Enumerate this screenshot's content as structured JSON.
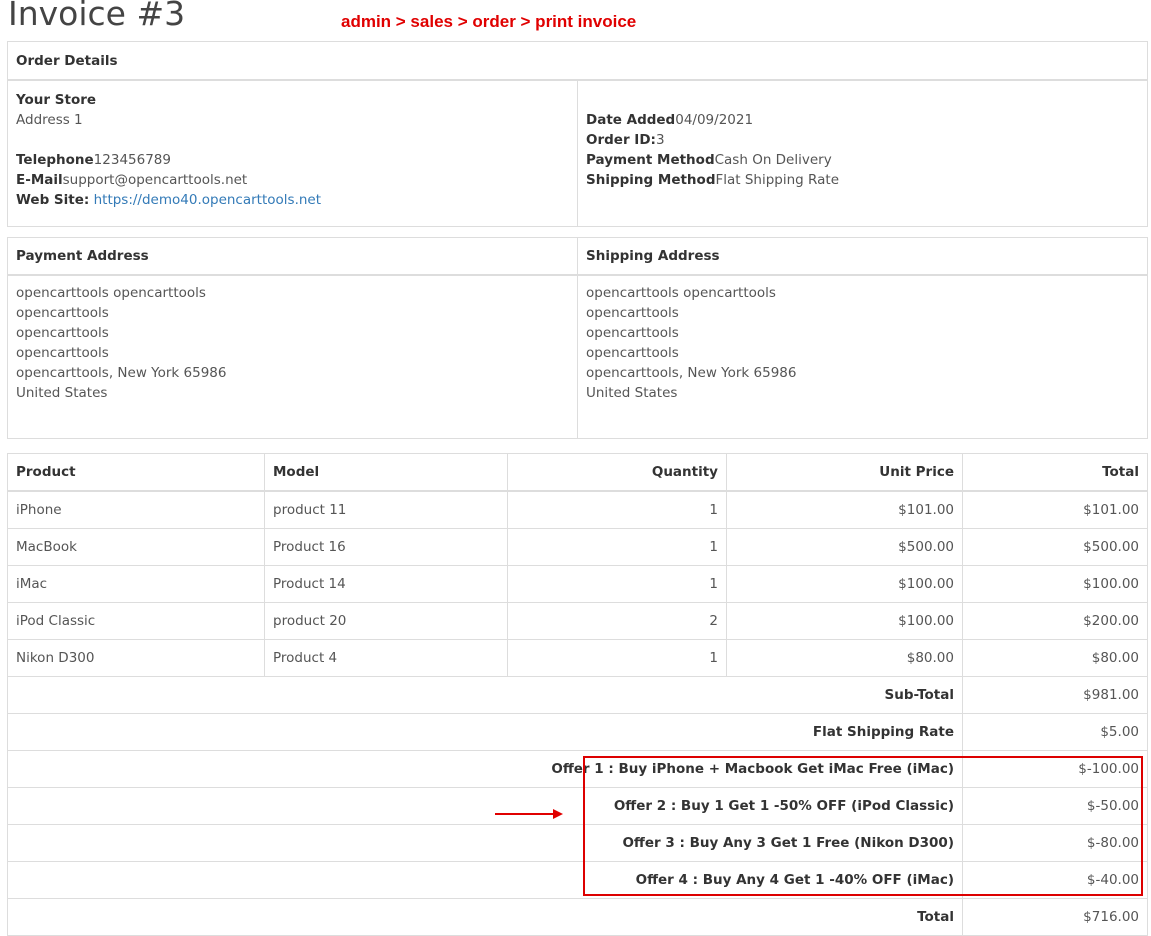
{
  "page_title": "Invoice #3",
  "breadcrumb": "admin > sales > order > print invoice",
  "order_details": {
    "heading": "Order Details",
    "store_name": "Your Store",
    "address": "Address 1",
    "telephone_label": "Telephone",
    "telephone": "123456789",
    "email_label": "E-Mail",
    "email": "support@opencarttools.net",
    "website_label": "Web Site:",
    "website": "https://demo40.opencarttools.net",
    "date_added_label": "Date Added",
    "date_added": "04/09/2021",
    "order_id_label": "Order ID:",
    "order_id": "3",
    "payment_method_label": "Payment Method",
    "payment_method": "Cash On Delivery",
    "shipping_method_label": "Shipping Method",
    "shipping_method": "Flat Shipping Rate"
  },
  "addresses": {
    "payment_heading": "Payment Address",
    "shipping_heading": "Shipping Address",
    "payment_lines": [
      "opencarttools opencarttools",
      "opencarttools",
      "opencarttools",
      "opencarttools",
      "opencarttools, New York 65986",
      "United States"
    ],
    "shipping_lines": [
      "opencarttools opencarttools",
      "opencarttools",
      "opencarttools",
      "opencarttools",
      "opencarttools, New York 65986",
      "United States"
    ]
  },
  "products": {
    "headers": [
      "Product",
      "Model",
      "Quantity",
      "Unit Price",
      "Total"
    ],
    "rows": [
      [
        "iPhone",
        "product 11",
        "1",
        "$101.00",
        "$101.00"
      ],
      [
        "MacBook",
        "Product 16",
        "1",
        "$500.00",
        "$500.00"
      ],
      [
        "iMac",
        "Product 14",
        "1",
        "$100.00",
        "$100.00"
      ],
      [
        "iPod Classic",
        "product 20",
        "2",
        "$100.00",
        "$200.00"
      ],
      [
        "Nikon D300",
        "Product 4",
        "1",
        "$80.00",
        "$80.00"
      ]
    ]
  },
  "totals": [
    {
      "label": "Sub-Total",
      "value": "$981.00"
    },
    {
      "label": "Flat Shipping Rate",
      "value": "$5.00"
    },
    {
      "label": "Offer 1 : Buy iPhone + Macbook Get iMac Free (iMac)",
      "value": "$-100.00"
    },
    {
      "label": "Offer 2 : Buy 1 Get 1 -50% OFF (iPod Classic)",
      "value": "$-50.00"
    },
    {
      "label": "Offer 3 : Buy Any 3 Get 1 Free (Nikon D300)",
      "value": "$-80.00"
    },
    {
      "label": "Offer 4 : Buy Any 4 Get 1 -40% OFF (iMac)",
      "value": "$-40.00"
    },
    {
      "label": "Total",
      "value": "$716.00"
    }
  ],
  "colors": {
    "annotation": "#e00000",
    "link": "#337ab7",
    "border": "#dddddd"
  }
}
